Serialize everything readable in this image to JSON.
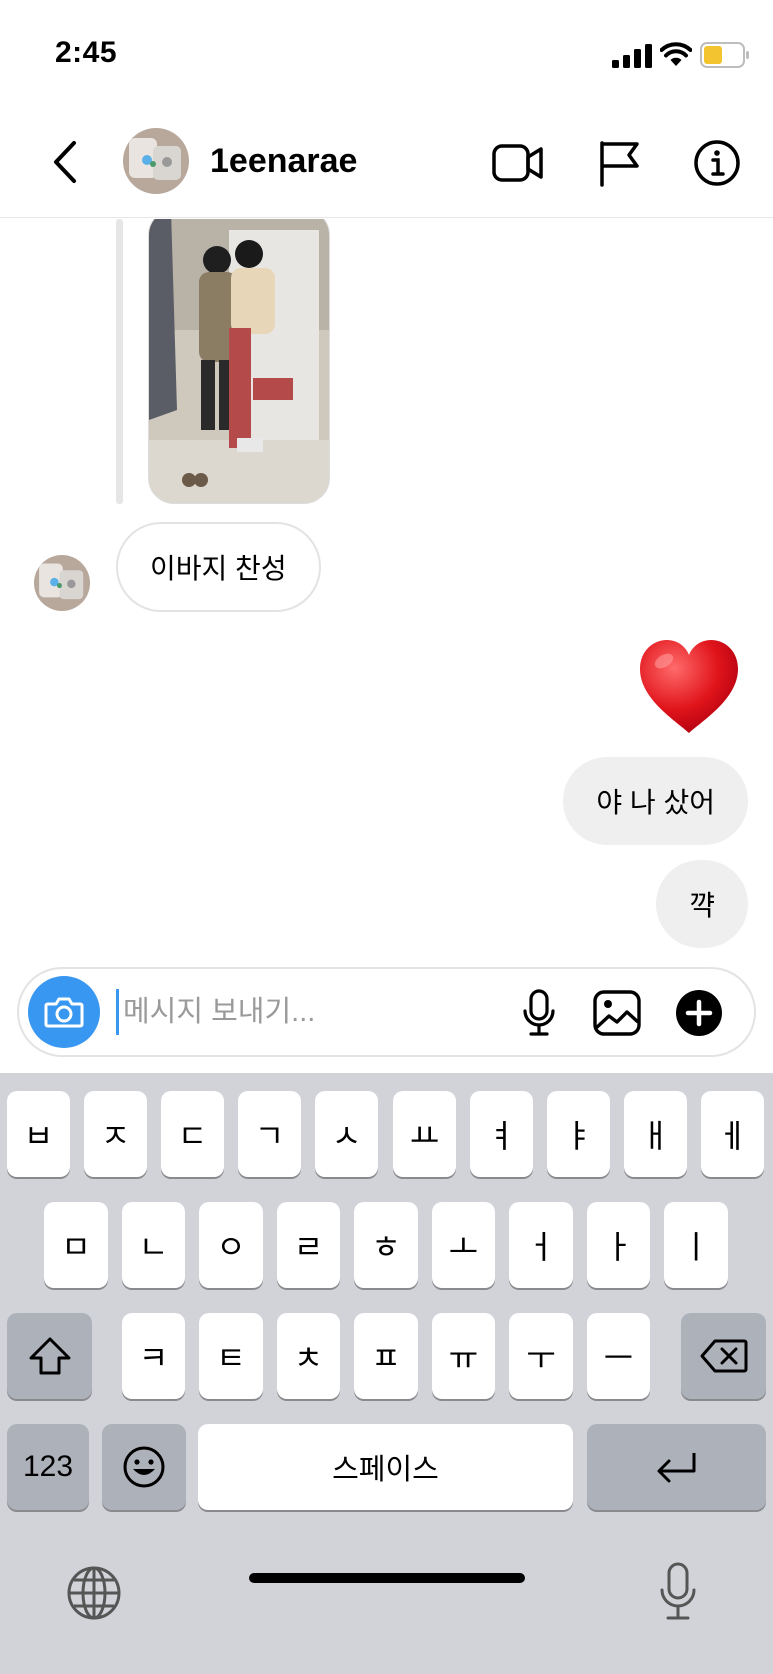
{
  "status": {
    "time": "2:45",
    "icons": [
      "cellular-signal-icon",
      "wifi-icon",
      "battery-icon"
    ],
    "battery_color": "#f4c430"
  },
  "header": {
    "username": "1eenarae",
    "icons": [
      "back-chevron-icon",
      "video-camera-icon",
      "flag-icon",
      "info-icon"
    ]
  },
  "messages": {
    "incoming": [
      {
        "type": "photo",
        "description_icon": "photo-icon"
      },
      {
        "type": "text",
        "text": "이바지 찬성"
      }
    ],
    "outgoing": [
      {
        "type": "emoji",
        "text": "❤️"
      },
      {
        "type": "text",
        "text": "야 나 샀어"
      },
      {
        "type": "text",
        "text": "꺅"
      }
    ]
  },
  "composer": {
    "placeholder": "메시지 보내기...",
    "value": "",
    "icons": [
      "camera-icon",
      "microphone-icon",
      "gallery-icon",
      "plus-icon"
    ],
    "accent": "#3897f0"
  },
  "keyboard": {
    "row1": [
      "ㅂ",
      "ㅈ",
      "ㄷ",
      "ㄱ",
      "ㅅ",
      "ㅛ",
      "ㅕ",
      "ㅑ",
      "ㅐ",
      "ㅔ"
    ],
    "row2": [
      "ㅁ",
      "ㄴ",
      "ㅇ",
      "ㄹ",
      "ㅎ",
      "ㅗ",
      "ㅓ",
      "ㅏ",
      "ㅣ"
    ],
    "row3": [
      "ㅋ",
      "ㅌ",
      "ㅊ",
      "ㅍ",
      "ㅠ",
      "ㅜ",
      "ㅡ"
    ],
    "numbers_label": "123",
    "space_label": "스페이스",
    "icons": [
      "shift-icon",
      "backspace-icon",
      "emoji-icon",
      "return-icon",
      "globe-icon",
      "dictation-icon"
    ]
  }
}
